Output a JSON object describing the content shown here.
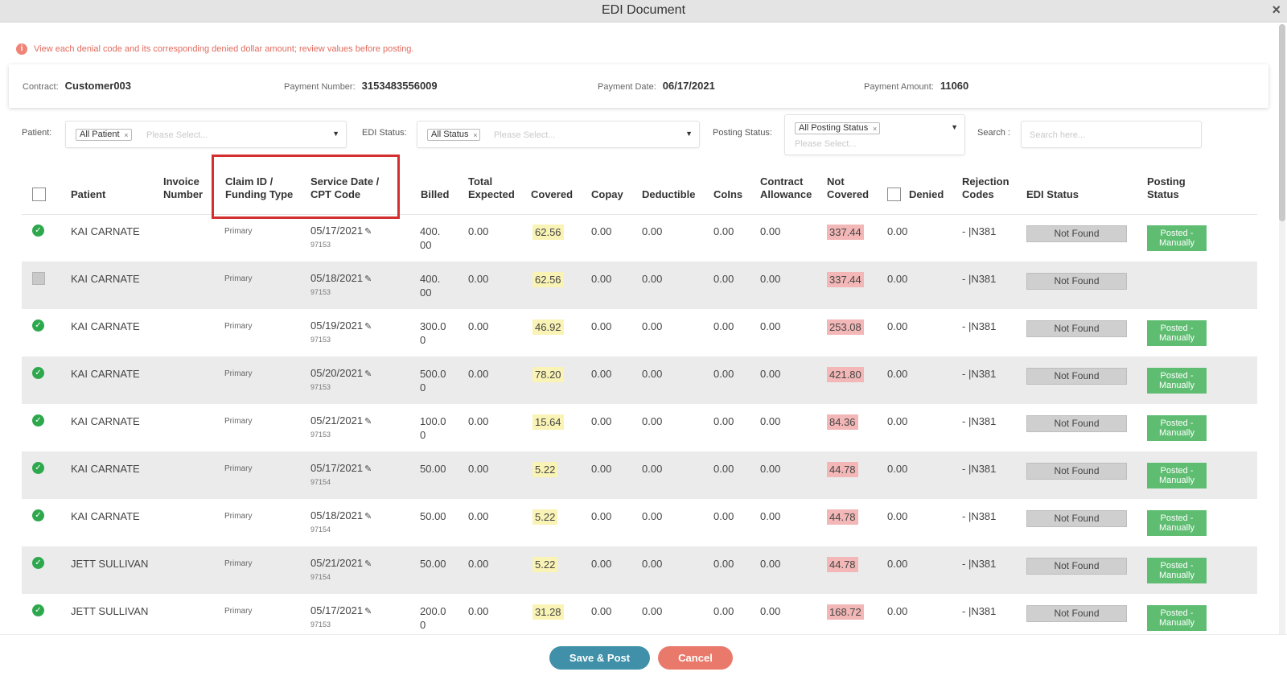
{
  "window": {
    "title": "EDI Document",
    "close_icon": "×"
  },
  "notice": {
    "icon": "info-icon",
    "text": "View each denial code and its corresponding denied dollar amount; review values before posting."
  },
  "info": {
    "contract_label": "Contract:",
    "contract_value": "Customer003",
    "payment_number_label": "Payment Number:",
    "payment_number_value": "3153483556009",
    "payment_date_label": "Payment Date:",
    "payment_date_value": "06/17/2021",
    "payment_amount_label": "Payment Amount:",
    "payment_amount_value": "11060"
  },
  "filters": {
    "patient_label": "Patient:",
    "patient_tag": "All Patient",
    "patient_placeholder": "Please Select...",
    "edi_status_label": "EDI Status:",
    "edi_status_tag": "All Status",
    "edi_status_placeholder": "Please Select...",
    "posting_status_label": "Posting Status:",
    "posting_status_tag": "All Posting Status",
    "posting_status_placeholder": "Please Select...",
    "search_label": "Search :",
    "search_placeholder": "Search here..."
  },
  "columns": {
    "patient": "Patient",
    "invoice_1": "Invoice",
    "invoice_2": "Number",
    "claim_1": "Claim ID /",
    "claim_2": "Funding Type",
    "service_1": "Service Date /",
    "service_2": "CPT Code",
    "billed": "Billed",
    "total_1": "Total",
    "total_2": "Expected",
    "covered": "Covered",
    "copay": "Copay",
    "deductible": "Deductible",
    "coins": "CoIns",
    "contract_1": "Contract",
    "contract_2": "Allowance",
    "notcov_1": "Not",
    "notcov_2": "Covered",
    "denied": "Denied",
    "rej_1": "Rejection",
    "rej_2": "Codes",
    "edi_status": "EDI Status",
    "posting_1": "Posting",
    "posting_2": "Status"
  },
  "rows": [
    {
      "status": "check",
      "patient": "KAI CARNATE",
      "funding": "Primary",
      "date": "05/17/2021",
      "cpt": "97153",
      "billed_1": "400.",
      "billed_2": "00",
      "expected": "0.00",
      "covered": "62.56",
      "copay": "0.00",
      "deductible": "0.00",
      "coins": "0.00",
      "allowance": "0.00",
      "not_covered": "337.44",
      "denied": "0.00",
      "rejection": "- |N381",
      "edi": "Not Found",
      "post_1": "Posted -",
      "post_2": "Manually"
    },
    {
      "status": "gray",
      "patient": "KAI CARNATE",
      "funding": "Primary",
      "date": "05/18/2021",
      "cpt": "97153",
      "billed_1": "400.",
      "billed_2": "00",
      "expected": "0.00",
      "covered": "62.56",
      "copay": "0.00",
      "deductible": "0.00",
      "coins": "0.00",
      "allowance": "0.00",
      "not_covered": "337.44",
      "denied": "0.00",
      "rejection": "- |N381",
      "edi": "Not Found",
      "post_1": "",
      "post_2": ""
    },
    {
      "status": "check",
      "patient": "KAI CARNATE",
      "funding": "Primary",
      "date": "05/19/2021",
      "cpt": "97153",
      "billed_1": "300.0",
      "billed_2": "0",
      "expected": "0.00",
      "covered": "46.92",
      "copay": "0.00",
      "deductible": "0.00",
      "coins": "0.00",
      "allowance": "0.00",
      "not_covered": "253.08",
      "denied": "0.00",
      "rejection": "- |N381",
      "edi": "Not Found",
      "post_1": "Posted -",
      "post_2": "Manually"
    },
    {
      "status": "check",
      "patient": "KAI CARNATE",
      "funding": "Primary",
      "date": "05/20/2021",
      "cpt": "97153",
      "billed_1": "500.0",
      "billed_2": "0",
      "expected": "0.00",
      "covered": "78.20",
      "copay": "0.00",
      "deductible": "0.00",
      "coins": "0.00",
      "allowance": "0.00",
      "not_covered": "421.80",
      "denied": "0.00",
      "rejection": "- |N381",
      "edi": "Not Found",
      "post_1": "Posted -",
      "post_2": "Manually"
    },
    {
      "status": "check",
      "patient": "KAI CARNATE",
      "funding": "Primary",
      "date": "05/21/2021",
      "cpt": "97153",
      "billed_1": "100.0",
      "billed_2": "0",
      "expected": "0.00",
      "covered": "15.64",
      "copay": "0.00",
      "deductible": "0.00",
      "coins": "0.00",
      "allowance": "0.00",
      "not_covered": "84.36",
      "denied": "0.00",
      "rejection": "- |N381",
      "edi": "Not Found",
      "post_1": "Posted -",
      "post_2": "Manually"
    },
    {
      "status": "check",
      "patient": "KAI CARNATE",
      "funding": "Primary",
      "date": "05/17/2021",
      "cpt": "97154",
      "billed_1": "50.00",
      "billed_2": "",
      "expected": "0.00",
      "covered": "5.22",
      "copay": "0.00",
      "deductible": "0.00",
      "coins": "0.00",
      "allowance": "0.00",
      "not_covered": "44.78",
      "denied": "0.00",
      "rejection": "- |N381",
      "edi": "Not Found",
      "post_1": "Posted -",
      "post_2": "Manually"
    },
    {
      "status": "check",
      "patient": "KAI CARNATE",
      "funding": "Primary",
      "date": "05/18/2021",
      "cpt": "97154",
      "billed_1": "50.00",
      "billed_2": "",
      "expected": "0.00",
      "covered": "5.22",
      "copay": "0.00",
      "deductible": "0.00",
      "coins": "0.00",
      "allowance": "0.00",
      "not_covered": "44.78",
      "denied": "0.00",
      "rejection": "- |N381",
      "edi": "Not Found",
      "post_1": "Posted -",
      "post_2": "Manually"
    },
    {
      "status": "check",
      "patient": "JETT SULLIVAN",
      "funding": "Primary",
      "date": "05/21/2021",
      "cpt": "97154",
      "billed_1": "50.00",
      "billed_2": "",
      "expected": "0.00",
      "covered": "5.22",
      "copay": "0.00",
      "deductible": "0.00",
      "coins": "0.00",
      "allowance": "0.00",
      "not_covered": "44.78",
      "denied": "0.00",
      "rejection": "- |N381",
      "edi": "Not Found",
      "post_1": "Posted -",
      "post_2": "Manually"
    },
    {
      "status": "check",
      "patient": "JETT SULLIVAN",
      "funding": "Primary",
      "date": "05/17/2021",
      "cpt": "97153",
      "billed_1": "200.0",
      "billed_2": "0",
      "expected": "0.00",
      "covered": "31.28",
      "copay": "0.00",
      "deductible": "0.00",
      "coins": "0.00",
      "allowance": "0.00",
      "not_covered": "168.72",
      "denied": "0.00",
      "rejection": "- |N381",
      "edi": "Not Found",
      "post_1": "Posted -",
      "post_2": "Manually"
    }
  ],
  "buttons": {
    "save": "Save & Post",
    "cancel": "Cancel"
  },
  "colors": {
    "save": "#3f90a8",
    "cancel": "#e97a6b",
    "posted": "#5fbd72",
    "covered_highlight": "#f9f3b5",
    "not_covered_highlight": "#f3b7b7",
    "highlight_box": "#d32f2f"
  }
}
